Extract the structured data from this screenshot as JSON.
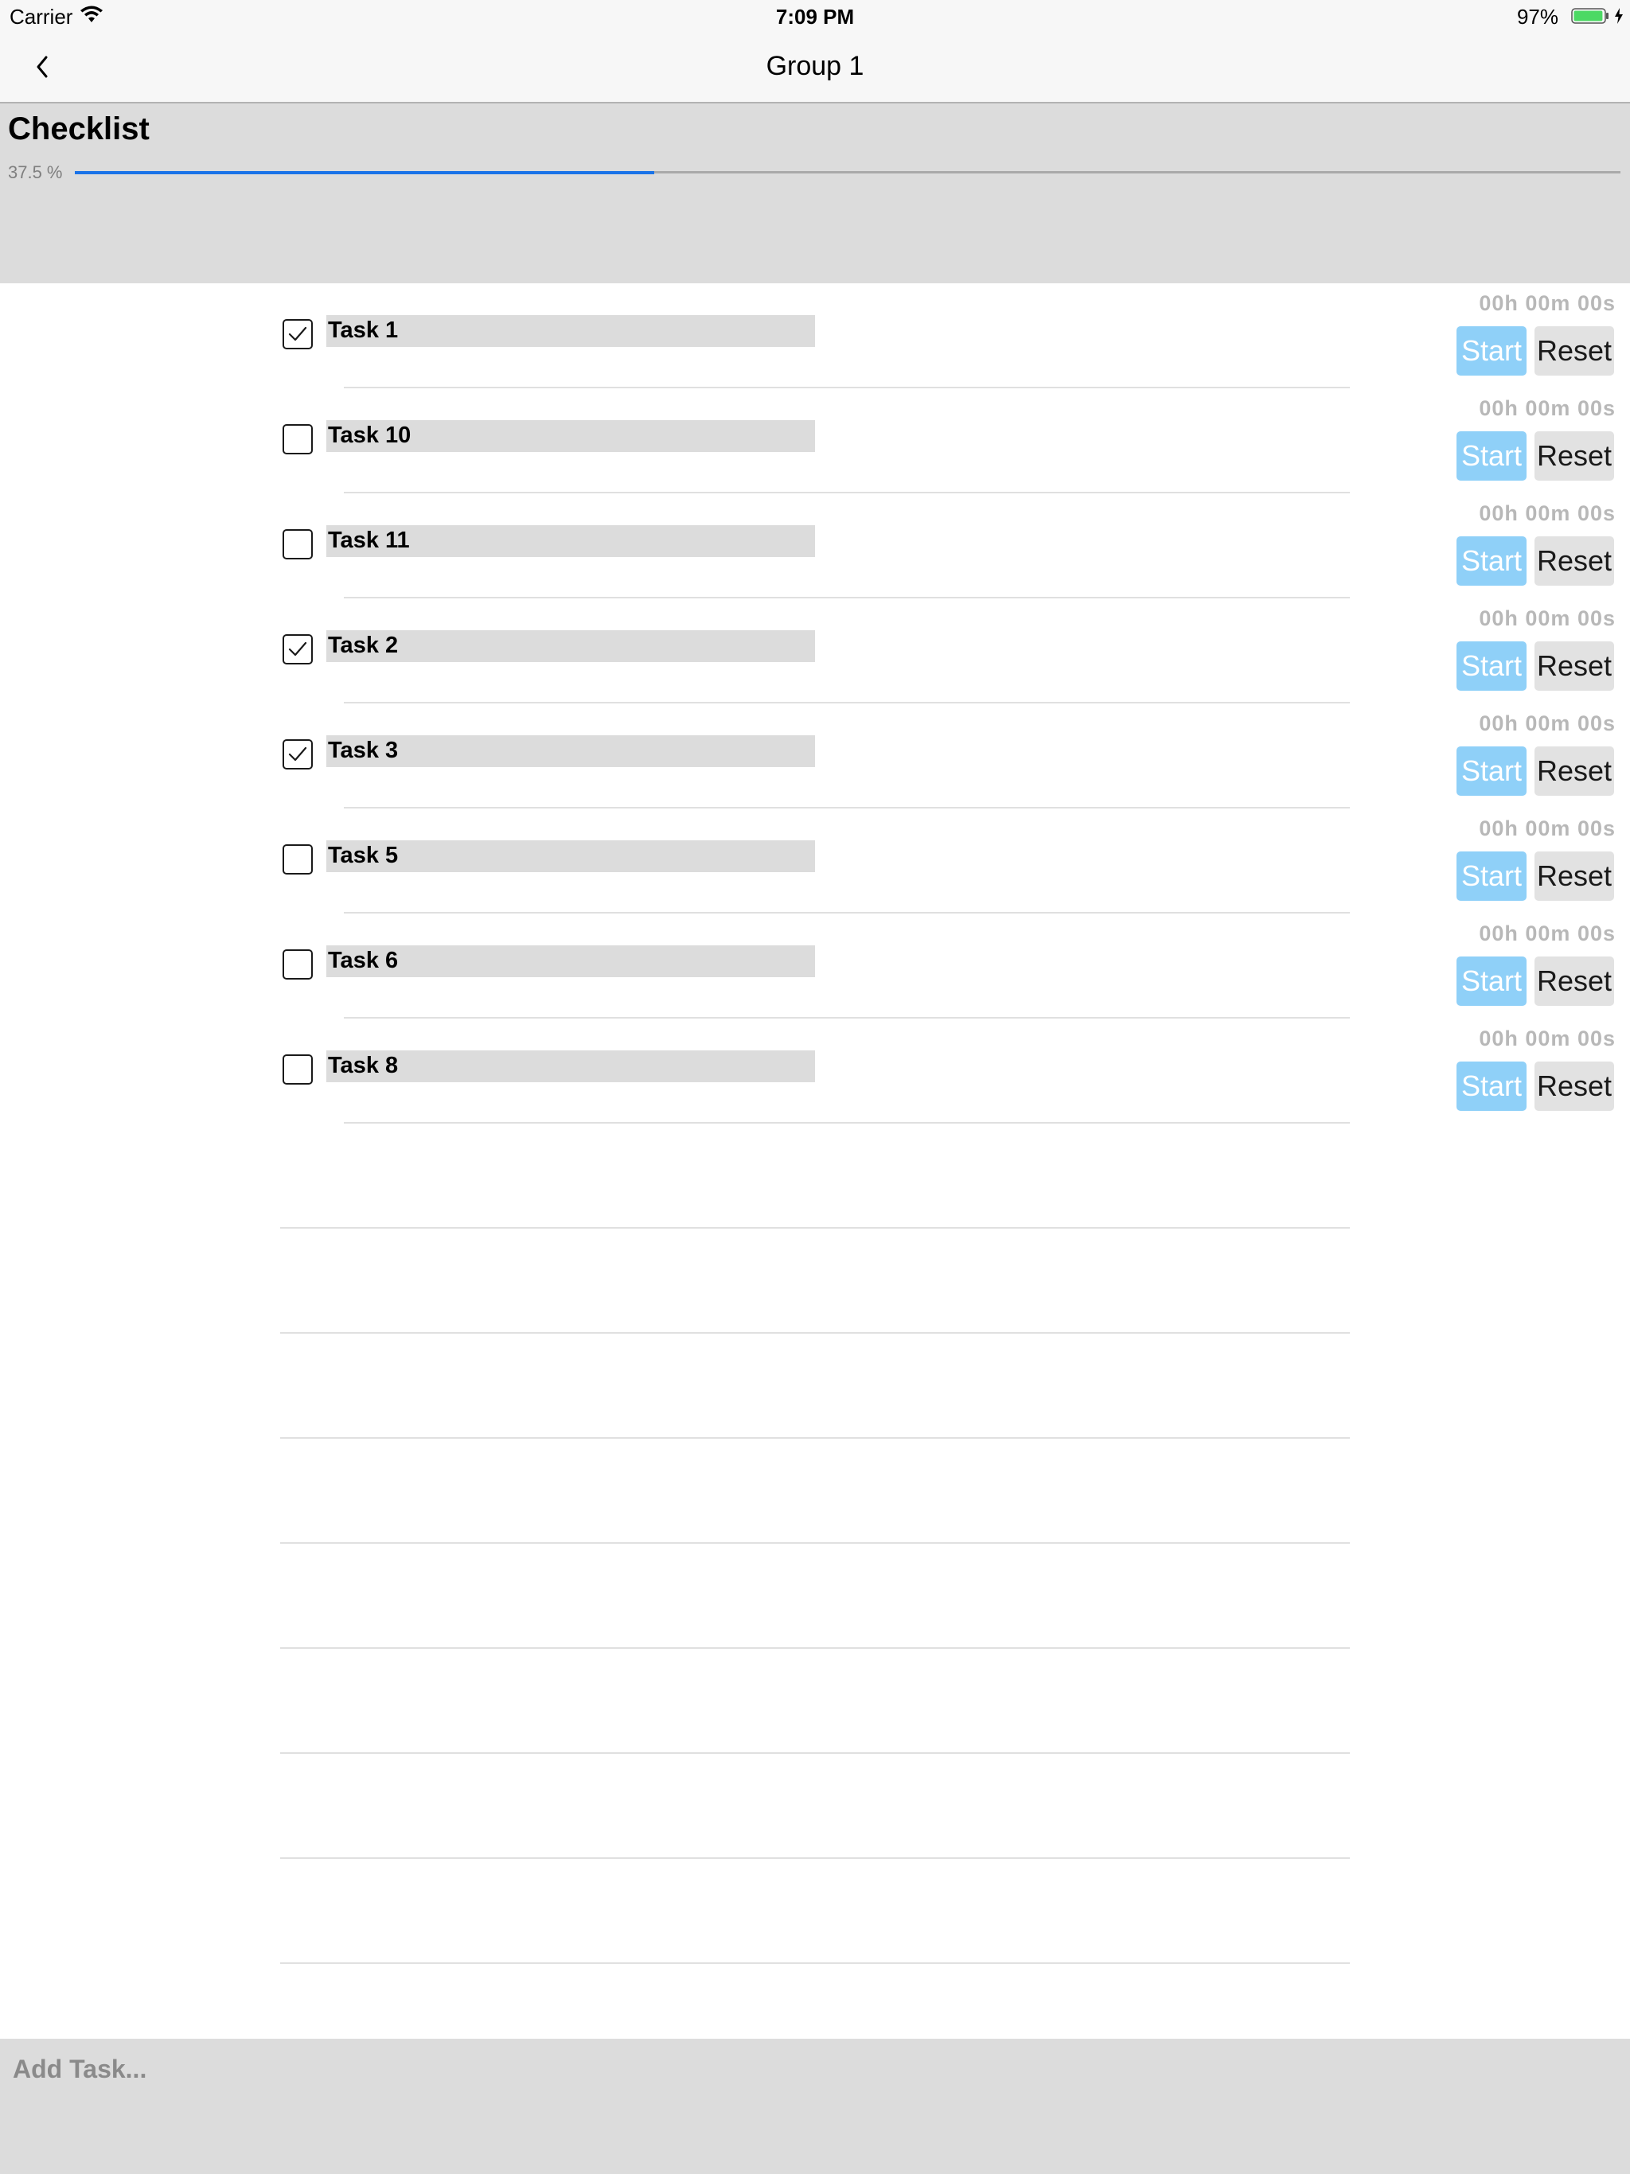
{
  "status_bar": {
    "carrier": "Carrier",
    "time": "7:09 PM",
    "battery_percent": "97%",
    "battery_level": 0.97,
    "icons": [
      "wifi-icon",
      "battery-icon",
      "charging-icon"
    ]
  },
  "nav": {
    "title": "Group 1",
    "back_icon": "chevron-left-icon"
  },
  "header": {
    "title": "Checklist",
    "progress_label": "37.5 %",
    "progress_value": 0.375,
    "progress_color": "#1a73e8"
  },
  "tasks": [
    {
      "name": "Task 1",
      "checked": true,
      "timer": "00h 00m 00s",
      "start_label": "Start",
      "reset_label": "Reset"
    },
    {
      "name": "Task 10",
      "checked": false,
      "timer": "00h 00m 00s",
      "start_label": "Start",
      "reset_label": "Reset"
    },
    {
      "name": "Task 11",
      "checked": false,
      "timer": "00h 00m 00s",
      "start_label": "Start",
      "reset_label": "Reset"
    },
    {
      "name": "Task 2",
      "checked": true,
      "timer": "00h 00m 00s",
      "start_label": "Start",
      "reset_label": "Reset"
    },
    {
      "name": "Task 3",
      "checked": true,
      "timer": "00h 00m 00s",
      "start_label": "Start",
      "reset_label": "Reset"
    },
    {
      "name": "Task 5",
      "checked": false,
      "timer": "00h 00m 00s",
      "start_label": "Start",
      "reset_label": "Reset"
    },
    {
      "name": "Task 6",
      "checked": false,
      "timer": "00h 00m 00s",
      "start_label": "Start",
      "reset_label": "Reset"
    },
    {
      "name": "Task 8",
      "checked": false,
      "timer": "00h 00m 00s",
      "start_label": "Start",
      "reset_label": "Reset"
    }
  ],
  "colors": {
    "start_button": "#8fd0f8",
    "reset_button": "#e2e2e2",
    "header_background": "#dcdcdc"
  },
  "footer": {
    "add_task_placeholder": "Add Task..."
  }
}
